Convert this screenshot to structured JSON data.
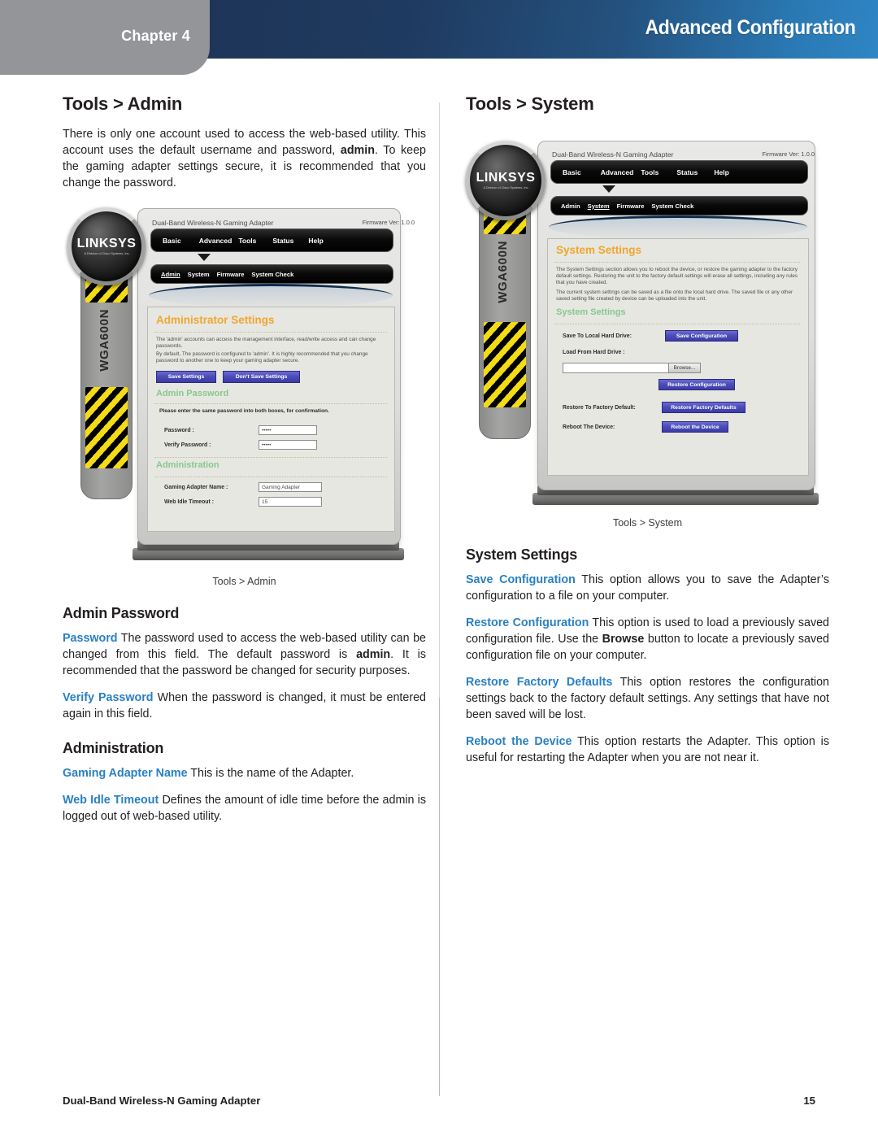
{
  "header": {
    "chapter_label": "Chapter 4",
    "title": "Advanced Configuration",
    "band_color_left": "#1e3558",
    "band_color_right": "#2e86c4",
    "tab_color": "#939598"
  },
  "footer": {
    "product": "Dual-Band Wireless-N Gaming Adapter",
    "page_number": "15"
  },
  "colors": {
    "term_blue": "#2980c4",
    "panel_title_orange": "#f0a62c",
    "panel_sub_green": "#86c88c",
    "button_purple": "#4a4ab8",
    "hazard_yellow": "#f3dc16"
  },
  "left_column": {
    "section_title": "Tools > Admin",
    "intro": {
      "part1": "There is only one account used to access the web-based utility. This account uses the default username and password, ",
      "bold1": "admin",
      "part2": ". To keep the gaming adapter settings secure, it is recommended that you change the password."
    },
    "figure_caption": "Tools > Admin",
    "admin_password_heading": "Admin Password",
    "password_para": {
      "term": "Password",
      "part1": "  The password used to access the web-based utility can be changed from this field. The default password is ",
      "bold1": "admin",
      "part2": ". It is recommended that the password be changed for security purposes."
    },
    "verify_password_para": {
      "term": "Verify Password",
      "text": "  When the password is changed, it must be entered again in this field."
    },
    "administration_heading": "Administration",
    "gaming_adapter_name_para": {
      "term": "Gaming Adapter Name",
      "text": " This is the name of the Adapter."
    },
    "web_idle_timeout_para": {
      "term": "Web Idle Timeout",
      "text": "  Defines the amount of idle time before the admin is logged out of web-based utility."
    }
  },
  "right_column": {
    "section_title": "Tools > System",
    "figure_caption": "Tools > System",
    "system_settings_heading": "System Settings",
    "save_configuration_para": {
      "term": "Save Configuration",
      "text": "  This option allows you to save the Adapter’s configuration to a file on your computer."
    },
    "restore_configuration_para": {
      "term": "Restore Configuration",
      "part1": " This option is used to load a previously saved configuration file. Use the ",
      "bold1": "Browse",
      "part2": " button to locate a previously saved configuration file on your computer."
    },
    "restore_factory_defaults_para": {
      "term": "Restore Factory Defaults",
      "text": " This option restores the configuration settings back to the factory default settings. Any settings that have not been saved will be lost."
    },
    "reboot_device_para": {
      "term": "Reboot the Device",
      "text": "  This option restarts the Adapter. This option is useful for restarting the Adapter when you are not near it."
    }
  },
  "admin_screenshot": {
    "brand": "LINKSYS",
    "brand_sub": "A Division of Cisco Systems, Inc.",
    "product_line": "Dual-Band Wireless-N Gaming Adapter",
    "firmware": "Firmware Ver: 1.0.0",
    "device_model": "WGA600N",
    "nav_tabs": [
      "Basic",
      "Advanced",
      "Tools",
      "Status",
      "Help"
    ],
    "nav_active": "Tools",
    "sub_tabs": [
      "Admin",
      "System",
      "Firmware",
      "System Check"
    ],
    "sub_active": "Admin",
    "panel_title": "Administrator Settings",
    "panel_text_1": "The 'admin' accounts can access the management interface, read/write access and can change passwords.",
    "panel_text_2": "By default, The password is configured to 'admin'. It is highly recommended that you change password to another one to keep your gaming adapter secure.",
    "save_button": "Save Settings",
    "cancel_button": "Don't Save Settings",
    "section_admin_password": "Admin Password",
    "admin_password_note": "Please enter the same password into both boxes, for confirmation.",
    "password_label": "Password :",
    "password_value": "•••••",
    "verify_password_label": "Verify Password :",
    "verify_password_value": "•••••",
    "section_administration": "Administration",
    "adapter_name_label": "Gaming Adapter Name :",
    "adapter_name_value": "Gaming Adapter",
    "idle_timeout_label": "Web Idle Timeout :",
    "idle_timeout_value": "15"
  },
  "system_screenshot": {
    "brand": "LINKSYS",
    "brand_sub": "A Division of Cisco Systems, Inc.",
    "product_line": "Dual-Band Wireless-N Gaming Adapter",
    "firmware": "Firmware Ver: 1.0.0",
    "device_model": "WGA600N",
    "nav_tabs": [
      "Basic",
      "Advanced",
      "Tools",
      "Status",
      "Help"
    ],
    "nav_active": "Tools",
    "sub_tabs": [
      "Admin",
      "System",
      "Firmware",
      "System Check"
    ],
    "sub_active": "System",
    "panel_title": "System Settings",
    "panel_text_1": "The System Settings section allows you to reboot the device, or restore the gaming adapter to the factory default settings. Restoring the unit to the factory default settings will erase all settings, including any rules that you have created.",
    "panel_text_2": "The current system settings can be saved as a file onto the local hard drive. The saved file or any other saved setting file created by device can be uploaded into the unit.",
    "section_system_settings": "System Settings",
    "save_local_label": "Save To Local Hard Drive:",
    "save_config_button": "Save Configuration",
    "load_label": "Load From Hard Drive :",
    "load_value": "",
    "browse_button": "Browse...",
    "restore_config_button": "Restore Configuration",
    "restore_factory_label": "Restore To Factory Default:",
    "restore_factory_button": "Restore Factory Defaults",
    "reboot_label": "Reboot The Device:",
    "reboot_button": "Reboot the Device"
  }
}
